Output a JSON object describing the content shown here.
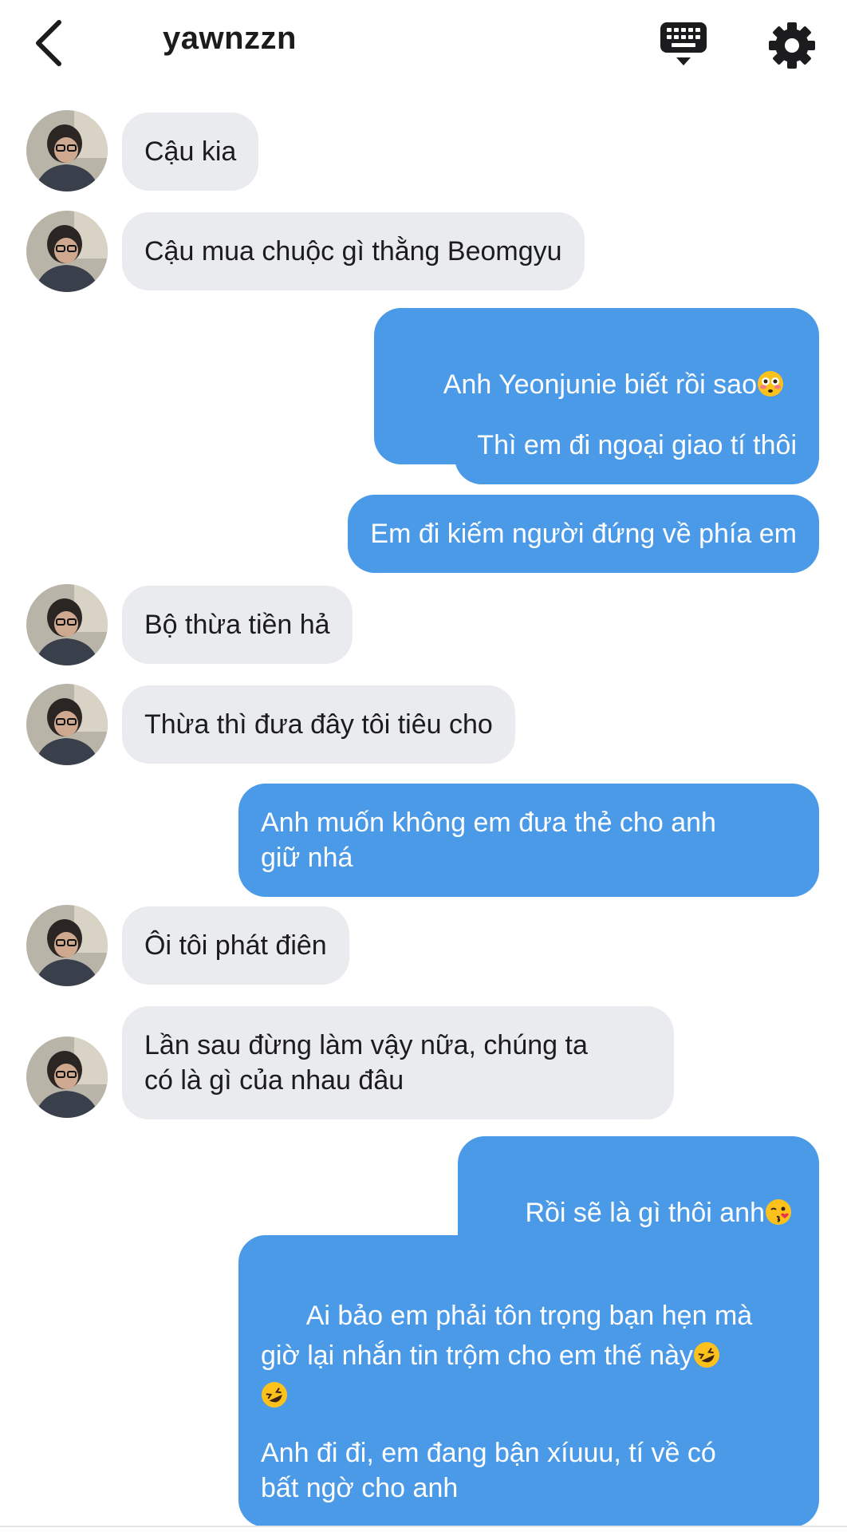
{
  "header": {
    "back_icon": "chevron-left-icon",
    "username": "yawnzzn",
    "keyboard_icon": "keyboard-icon",
    "settings_icon": "gear-icon"
  },
  "colors": {
    "incoming_bubble": "#e9ebee",
    "outgoing_bubble": "#4b9ae8",
    "text_dark": "#1c1c1e",
    "text_light": "#ffffff"
  },
  "messages": [
    {
      "sender": "them",
      "text": "Cậu kia",
      "avatar": true
    },
    {
      "sender": "them",
      "text": "Cậu mua chuộc gì thằng Beomgyu",
      "avatar": true
    },
    {
      "sender": "me",
      "text": "Anh Yeonjunie biết rồi sao",
      "emoji": "flushed-face"
    },
    {
      "sender": "me",
      "text": "Thì em đi ngoại giao tí thôi"
    },
    {
      "sender": "me",
      "text": "Em đi kiếm người đứng về phía em"
    },
    {
      "sender": "them",
      "text": "Bộ thừa tiền hả",
      "avatar": true
    },
    {
      "sender": "them",
      "text": "Thừa thì đưa đây tôi tiêu cho",
      "avatar": true
    },
    {
      "sender": "me",
      "text": "Anh muốn không em đưa thẻ cho anh\ngiữ nhá"
    },
    {
      "sender": "them",
      "text": "Ôi tôi phát điên",
      "avatar": true
    },
    {
      "sender": "them",
      "text": "Lần sau đừng làm vậy nữa, chúng ta\ncó là gì của nhau đâu",
      "avatar": true
    },
    {
      "sender": "me",
      "text": "Rồi sẽ là gì thôi anh",
      "emoji": "kissing-face"
    },
    {
      "sender": "me",
      "text": "Ai bảo em phải tôn trọng bạn hẹn mà\ngiờ lại nhắn tin trộm cho em thế này",
      "emoji": "rofl-face",
      "emoji2": "rofl-face"
    },
    {
      "sender": "me",
      "text": "Anh đi đi, em đang bận xíuuu, tí về có\nbất ngờ cho anh"
    }
  ]
}
